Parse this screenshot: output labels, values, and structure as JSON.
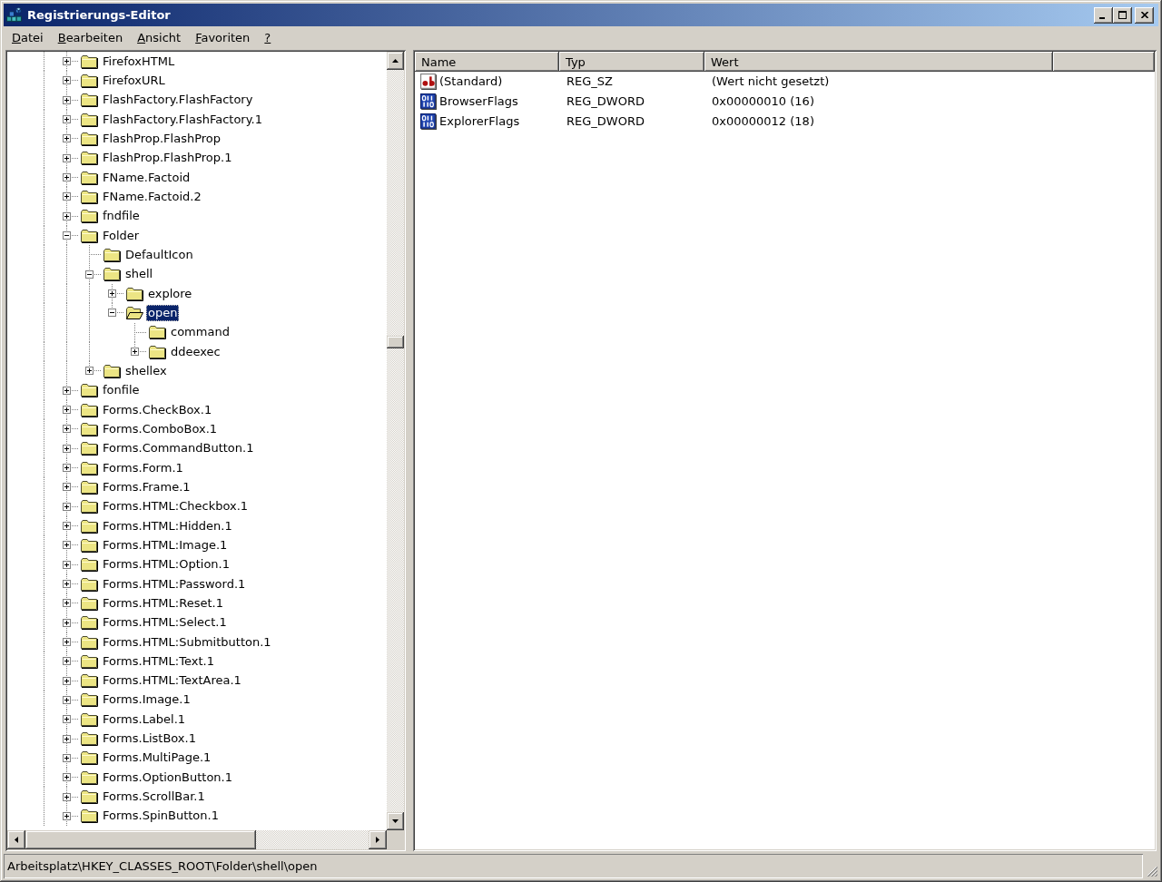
{
  "window": {
    "title": "Registrierungs-Editor"
  },
  "menu": [
    "Datei",
    "Bearbeiten",
    "Ansicht",
    "Favoriten",
    "?"
  ],
  "tree": {
    "items": [
      {
        "label": "FirefoxHTML",
        "expanded": false,
        "selected": false
      },
      {
        "label": "FirefoxURL",
        "expanded": false,
        "selected": false
      },
      {
        "label": "FlashFactory.FlashFactory",
        "expanded": false,
        "selected": false
      },
      {
        "label": "FlashFactory.FlashFactory.1",
        "expanded": false,
        "selected": false
      },
      {
        "label": "FlashProp.FlashProp",
        "expanded": false,
        "selected": false
      },
      {
        "label": "FlashProp.FlashProp.1",
        "expanded": false,
        "selected": false
      },
      {
        "label": "FName.Factoid",
        "expanded": false,
        "selected": false
      },
      {
        "label": "FName.Factoid.2",
        "expanded": false,
        "selected": false
      },
      {
        "label": "fndfile",
        "expanded": false,
        "selected": false
      },
      {
        "label": "Folder",
        "expanded": true,
        "selected": false,
        "children": [
          {
            "label": "DefaultIcon",
            "selected": false
          },
          {
            "label": "shell",
            "expanded": true,
            "selected": false,
            "children": [
              {
                "label": "explore",
                "expanded": false,
                "selected": false
              },
              {
                "label": "open",
                "expanded": true,
                "selected": true,
                "children": [
                  {
                    "label": "command",
                    "selected": false
                  },
                  {
                    "label": "ddeexec",
                    "expanded": false,
                    "selected": false
                  }
                ]
              }
            ]
          },
          {
            "label": "shellex",
            "expanded": false,
            "selected": false
          }
        ]
      },
      {
        "label": "fonfile",
        "expanded": false,
        "selected": false
      },
      {
        "label": "Forms.CheckBox.1",
        "expanded": false,
        "selected": false
      },
      {
        "label": "Forms.ComboBox.1",
        "expanded": false,
        "selected": false
      },
      {
        "label": "Forms.CommandButton.1",
        "expanded": false,
        "selected": false
      },
      {
        "label": "Forms.Form.1",
        "expanded": false,
        "selected": false
      },
      {
        "label": "Forms.Frame.1",
        "expanded": false,
        "selected": false
      },
      {
        "label": "Forms.HTML:Checkbox.1",
        "expanded": false,
        "selected": false
      },
      {
        "label": "Forms.HTML:Hidden.1",
        "expanded": false,
        "selected": false
      },
      {
        "label": "Forms.HTML:Image.1",
        "expanded": false,
        "selected": false
      },
      {
        "label": "Forms.HTML:Option.1",
        "expanded": false,
        "selected": false
      },
      {
        "label": "Forms.HTML:Password.1",
        "expanded": false,
        "selected": false
      },
      {
        "label": "Forms.HTML:Reset.1",
        "expanded": false,
        "selected": false
      },
      {
        "label": "Forms.HTML:Select.1",
        "expanded": false,
        "selected": false
      },
      {
        "label": "Forms.HTML:Submitbutton.1",
        "expanded": false,
        "selected": false
      },
      {
        "label": "Forms.HTML:Text.1",
        "expanded": false,
        "selected": false
      },
      {
        "label": "Forms.HTML:TextArea.1",
        "expanded": false,
        "selected": false
      },
      {
        "label": "Forms.Image.1",
        "expanded": false,
        "selected": false
      },
      {
        "label": "Forms.Label.1",
        "expanded": false,
        "selected": false
      },
      {
        "label": "Forms.ListBox.1",
        "expanded": false,
        "selected": false
      },
      {
        "label": "Forms.MultiPage.1",
        "expanded": false,
        "selected": false
      },
      {
        "label": "Forms.OptionButton.1",
        "expanded": false,
        "selected": false
      },
      {
        "label": "Forms.ScrollBar.1",
        "expanded": false,
        "selected": false
      },
      {
        "label": "Forms.SpinButton.1",
        "expanded": false,
        "selected": false
      }
    ]
  },
  "values": {
    "columns": [
      "Name",
      "Typ",
      "Wert"
    ],
    "rows": [
      {
        "kind": "string",
        "name": "(Standard)",
        "data_type": "REG_SZ",
        "data": "(Wert nicht gesetzt)",
        "selected": false
      },
      {
        "kind": "dword",
        "name": "BrowserFlags",
        "data_type": "REG_DWORD",
        "data": "0x00000010 (16)",
        "selected": false
      },
      {
        "kind": "dword",
        "name": "ExplorerFlags",
        "data_type": "REG_DWORD",
        "data": "0x00000012 (18)",
        "selected": false
      }
    ]
  },
  "status_bar": {
    "text": "Arbeitsplatz\\HKEY_CLASSES_ROOT\\Folder\\shell\\open"
  }
}
